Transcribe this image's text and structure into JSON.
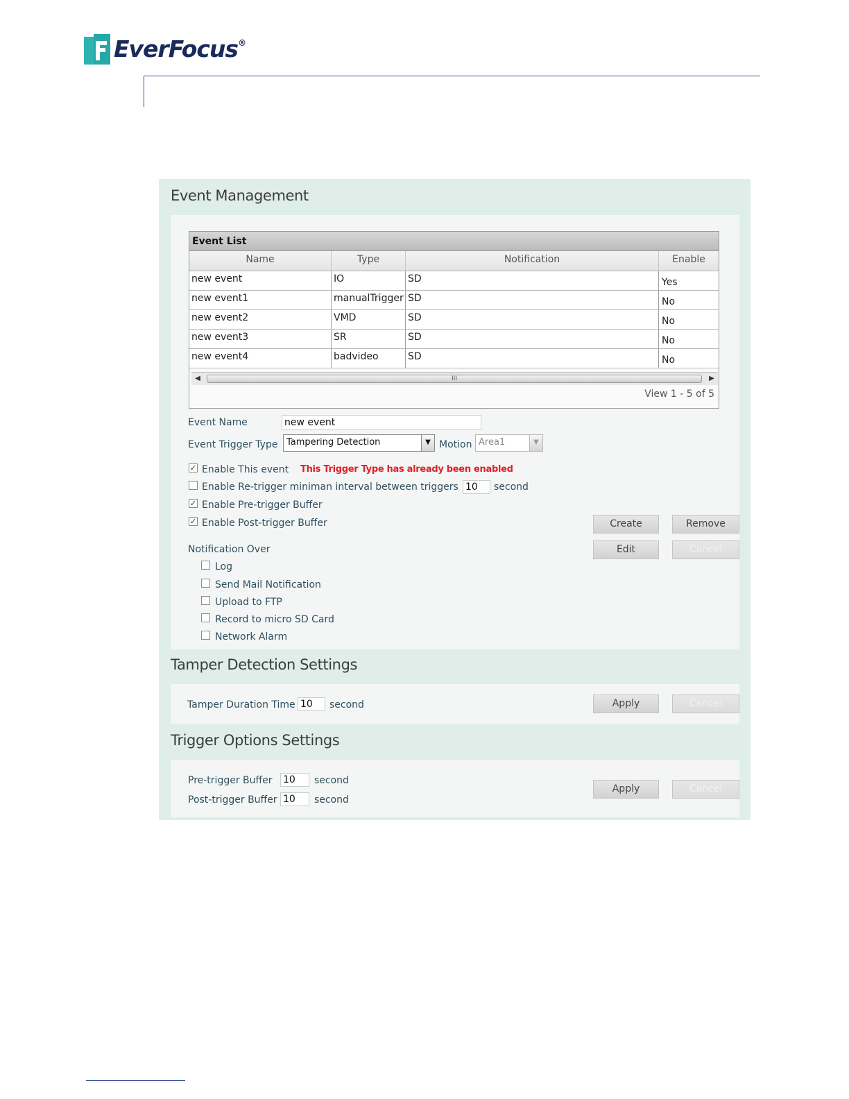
{
  "doc_header": {
    "brand": "EverFocus",
    "reg_mark": "®"
  },
  "event_management": {
    "title": "Event Management",
    "event_list": {
      "title": "Event List",
      "columns": [
        "Name",
        "Type",
        "Notification",
        "Enable"
      ],
      "rows": [
        [
          "new event",
          "IO",
          "SD",
          "Yes"
        ],
        [
          "new event1",
          "manualTrigger",
          "SD",
          "No"
        ],
        [
          "new event2",
          "VMD",
          "SD",
          "No"
        ],
        [
          "new event3",
          "SR",
          "SD",
          "No"
        ],
        [
          "new event4",
          "badvideo",
          "SD",
          "No"
        ]
      ],
      "scroll_grip": "III",
      "pager": "View 1 - 5 of 5"
    },
    "event_name": {
      "label": "Event Name",
      "value": "new event"
    },
    "trigger_type": {
      "label": "Event Trigger Type",
      "value": "Tampering Detection"
    },
    "motion": {
      "label": "Motion",
      "value": "Area1"
    },
    "enable_event": {
      "label": "Enable This event",
      "checked": true
    },
    "warning": "This Trigger Type has already been enabled",
    "retrigger": {
      "label": "Enable Re-trigger miniman interval between triggers",
      "value": "10",
      "unit": "second",
      "checked": false
    },
    "pre_buffer": {
      "label": "Enable Pre-trigger Buffer",
      "checked": true
    },
    "post_buffer": {
      "label": "Enable Post-trigger Buffer",
      "checked": true
    },
    "buttons": {
      "create": "Create",
      "remove": "Remove",
      "edit": "Edit",
      "cancel": "Cancel"
    },
    "notification": {
      "label": "Notification Over",
      "options": [
        "Log",
        "Send Mail Notification",
        "Upload to FTP",
        "Record to micro SD Card",
        "Network Alarm"
      ]
    }
  },
  "tamper": {
    "title": "Tamper Detection Settings",
    "duration_label": "Tamper Duration Time",
    "duration_value": "10",
    "unit": "second",
    "apply": "Apply",
    "cancel": "Cancel"
  },
  "trigger_options": {
    "title": "Trigger Options Settings",
    "pre_label": "Pre-trigger Buffer",
    "pre_value": "10",
    "post_label": "Post-trigger Buffer",
    "post_value": "10",
    "unit": "second",
    "apply": "Apply",
    "cancel": "Cancel"
  },
  "colors": {
    "brand_teal": "#2fb3b0",
    "brand_navy": "#1a2a5a",
    "panel_bg": "#dfeee8",
    "warning_red": "#e0202a"
  },
  "icons": [
    "everfocus-logo-icon",
    "dropdown-arrow-icon",
    "scroll-left-icon",
    "scroll-right-icon",
    "checkbox-checked-icon",
    "checkbox-empty-icon"
  ]
}
